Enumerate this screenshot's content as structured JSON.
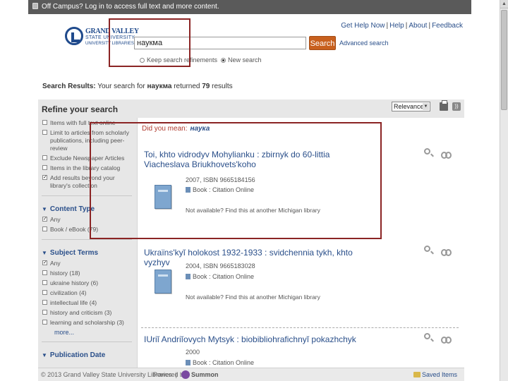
{
  "topbar": {
    "text": "Off Campus? Log in to access full text and more content."
  },
  "header": {
    "logo": {
      "line1": "GRAND VALLEY",
      "line2": "STATE UNIVERSITY",
      "line3": "UNIVERSITY LIBRARIES"
    },
    "links": [
      "Get Help Now",
      "Help",
      "About",
      "Feedback"
    ],
    "search": {
      "value": "наукма",
      "button": "Search",
      "advanced": "Advanced search"
    },
    "options": {
      "keep": "Keep search refinements",
      "new": "New search"
    }
  },
  "results_line": {
    "prefix": "Search Results:",
    "mid": "Your search for",
    "term": "наукма",
    "returned": "returned",
    "count": "79",
    "suffix": "results"
  },
  "sidebar": {
    "title": "Refine your search",
    "limits": [
      {
        "label": "Items with full text online",
        "checked": false
      },
      {
        "label": "Limit to articles from scholarly publications, including peer-review",
        "checked": false
      },
      {
        "label": "Exclude Newspaper Articles",
        "checked": false
      },
      {
        "label": "Items in the library catalog",
        "checked": false
      },
      {
        "label": "Add results beyond your library's collection",
        "checked": true
      }
    ],
    "content_type": {
      "title": "Content Type",
      "options": [
        {
          "label": "Any",
          "checked": true
        },
        {
          "label": "Book / eBook (79)",
          "checked": false
        }
      ]
    },
    "subject_terms": {
      "title": "Subject Terms",
      "options": [
        {
          "label": "Any",
          "checked": true
        },
        {
          "label": "history (18)",
          "checked": false
        },
        {
          "label": "ukraine history (6)",
          "checked": false
        },
        {
          "label": "civilization (4)",
          "checked": false
        },
        {
          "label": "intellectual life (4)",
          "checked": false
        },
        {
          "label": "history and criticism (3)",
          "checked": false
        },
        {
          "label": "learning and scholarship (3)",
          "checked": false
        }
      ],
      "more": "more..."
    },
    "publication_date": "Publication Date"
  },
  "sort": {
    "selected": "Relevance"
  },
  "did_you_mean": {
    "label": "Did you mean:",
    "suggestion": "наука"
  },
  "results": [
    {
      "title": "Toi, khto vidrodyv Mohylianku : zbirnyk do 60-littia Viacheslava Briukhovets'koho",
      "year_isbn": "2007, ISBN 9665184156",
      "format": "Book : Citation Online",
      "not_available": "Not available? Find this at another Michigan library"
    },
    {
      "title": "Ukraïns'kyĭ holokost 1932-1933 : svidchennia tykh, khto vyzhyv",
      "year_isbn": "2004, ISBN 9665183028",
      "format": "Book : Citation Online",
      "not_available": "Not available? Find this at another Michigan library"
    },
    {
      "title": "IUriĭ Andriĭovych Mytsyk : biobibliohrafichnyĭ pokazhchyk",
      "year_isbn": "2000",
      "format": "Book : Citation Online",
      "not_available": ""
    }
  ],
  "footer": {
    "copyright": "2013 Grand Valley State University Libraries",
    "powered": "Powered by",
    "brand": "Summon",
    "saved": "Saved Items (0)"
  }
}
